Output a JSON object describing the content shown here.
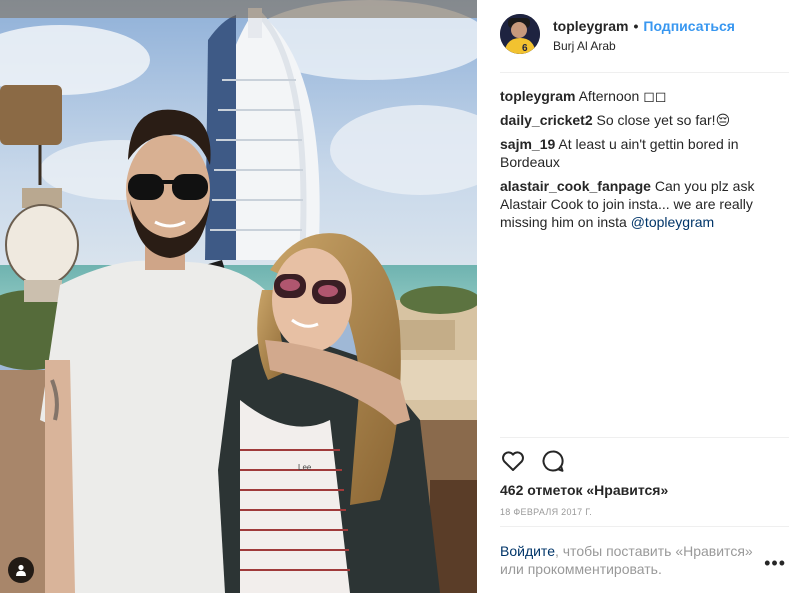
{
  "header": {
    "username": "topleygram",
    "separator": "•",
    "follow_label": "Подписаться",
    "location": "Burj Al Arab"
  },
  "comments": [
    {
      "user": "topleygram",
      "text": "Afternoon ◻◻"
    },
    {
      "user": "daily_cricket2",
      "text": "So close yet so far!😔"
    },
    {
      "user": "sajm_19",
      "text": "At least u ain't gettin bored in Bordeaux"
    },
    {
      "user": "alastair_cook_fanpage",
      "text": "Can you plz ask Alastair Cook to join insta... we are really missing him on insta",
      "mention": "@topleygram"
    }
  ],
  "photo": {
    "shirt_print": "Lee"
  },
  "actions": {
    "like_icon": "heart-outline-icon",
    "comment_icon": "speech-bubble-icon",
    "likes_text": "462 отметок «Нравится»",
    "date": "18 ФЕВРАЛЯ 2017 Г."
  },
  "login_prompt": {
    "link": "Войдите",
    "text": ", чтобы поставить «Нравится» или прокомментировать."
  },
  "more_label": "•••",
  "colors": {
    "link_blue": "#3897f0",
    "mention_dark_blue": "#003569",
    "muted_gray": "#999999",
    "text": "#262626",
    "divider": "#efefef"
  }
}
